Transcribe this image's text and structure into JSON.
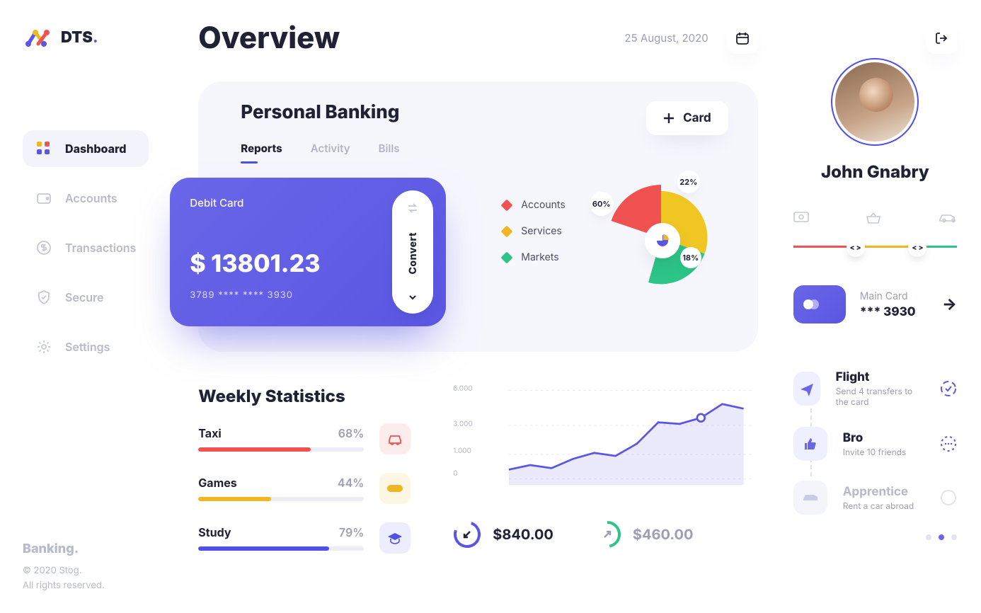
{
  "brand": {
    "name": "DTS",
    "dot": "."
  },
  "sidebar": {
    "items": [
      {
        "label": "Dashboard",
        "icon": "dashboard"
      },
      {
        "label": "Accounts",
        "icon": "accounts"
      },
      {
        "label": "Transactions",
        "icon": "transactions"
      },
      {
        "label": "Secure",
        "icon": "secure"
      },
      {
        "label": "Settings",
        "icon": "settings"
      }
    ],
    "footer": {
      "brand": "Banking.",
      "copyright": "© 2020 Stog.",
      "rights": "All rights reserved."
    }
  },
  "header": {
    "title": "Overview",
    "date": "25 August, 2020"
  },
  "banking": {
    "title": "Personal Banking",
    "tabs": [
      "Reports",
      "Activity",
      "Bills"
    ],
    "add_card": "Card",
    "card": {
      "type": "Debit Card",
      "balance": "$ 13801.23",
      "number": "3789 **** **** 3930",
      "convert": "Convert"
    },
    "legend": [
      {
        "label": "Accounts",
        "color": "#f05252"
      },
      {
        "label": "Services",
        "color": "#f0b722"
      },
      {
        "label": "Markets",
        "color": "#2dc487"
      }
    ],
    "donut": {
      "v1": "60%",
      "v2": "22%",
      "v3": "18%"
    }
  },
  "weekly": {
    "title": "Weekly Statistics",
    "stats": [
      {
        "label": "Taxi",
        "pct": "68%",
        "pctn": 68,
        "color": "#f05252",
        "icon": "car"
      },
      {
        "label": "Games",
        "pct": "44%",
        "pctn": 44,
        "color": "#f0b722",
        "icon": "game"
      },
      {
        "label": "Study",
        "pct": "79%",
        "pctn": 79,
        "color": "#5050e6",
        "icon": "grad"
      }
    ],
    "yticks": [
      "6.000",
      "3.000",
      "1.000",
      "0"
    ],
    "totals": [
      {
        "amount": "$840.00",
        "dir": "in",
        "color": "#5050e6"
      },
      {
        "amount": "$460.00",
        "dir": "out",
        "color": "#2dc487",
        "muted": true
      }
    ]
  },
  "profile": {
    "name": "John Gnabry",
    "main_card": {
      "label": "Main Card",
      "masked": "*** 3930"
    }
  },
  "tasks": [
    {
      "title": "Flight",
      "sub": "Send 4 transfers to the card",
      "icon": "plane",
      "state": "active"
    },
    {
      "title": "Bro",
      "sub": "Invite 10 friends",
      "icon": "thumb",
      "state": "pending"
    },
    {
      "title": "Apprentice",
      "sub": "Rent a car abroad",
      "icon": "car2",
      "state": "fade"
    }
  ],
  "chart_data": {
    "type": "line",
    "title": "Weekly Statistics",
    "ylim": [
      0,
      6000
    ],
    "yticks": [
      0,
      1000,
      3000,
      6000
    ],
    "x": [
      0,
      1,
      2,
      3,
      4,
      5,
      6,
      7,
      8,
      9,
      10,
      11
    ],
    "values": [
      700,
      900,
      800,
      1200,
      1500,
      1400,
      2000,
      3200,
      3100,
      3400,
      4100,
      3900
    ],
    "marker_index": 9
  },
  "colors": {
    "accent": "#5a56e3",
    "red": "#f05252",
    "yellow": "#f0b722",
    "green": "#2dc487"
  }
}
